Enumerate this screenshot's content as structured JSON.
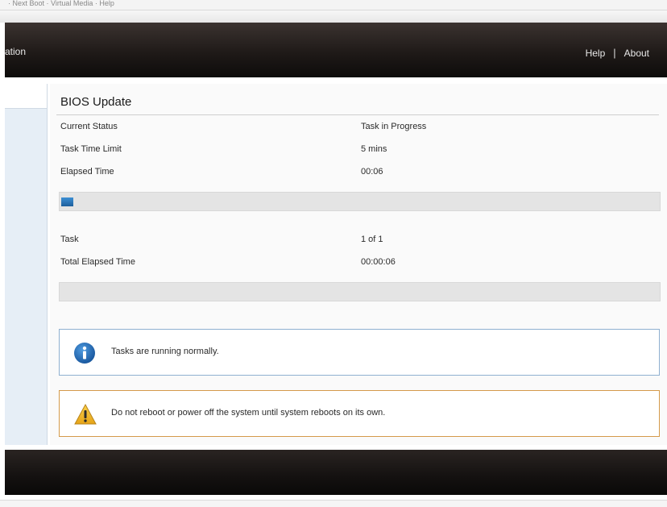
{
  "browser": {
    "menu_fragment": "· Next Boot · Virtual Media · Help"
  },
  "header": {
    "app_title": "ation",
    "help_label": "Help",
    "separator": "|",
    "about_label": "About"
  },
  "page": {
    "title": "BIOS Update",
    "rows": [
      {
        "label": "Current Status",
        "value": "Task in Progress"
      },
      {
        "label": "Task Time Limit",
        "value": "5 mins"
      },
      {
        "label": "Elapsed Time",
        "value": "00:06"
      }
    ],
    "task_progress_fraction": 0.02,
    "summary_rows": [
      {
        "label": "Task",
        "value": "1 of 1"
      },
      {
        "label": "Total Elapsed Time",
        "value": "00:00:06"
      }
    ],
    "total_progress_fraction": 0.0,
    "info_message": "Tasks are running normally.",
    "warning_message": "Do not reboot or power off the system until system reboots on its own."
  },
  "icons": {
    "info": "info-icon",
    "warning": "warning-icon"
  },
  "colors": {
    "header_bg": "#1f1a18",
    "progress_fill": "#1d5f9c",
    "info_border": "#8fb0d0",
    "warning_border": "#d49a4a",
    "warning_icon": "#f2b224",
    "info_icon": "#1f6db5"
  }
}
